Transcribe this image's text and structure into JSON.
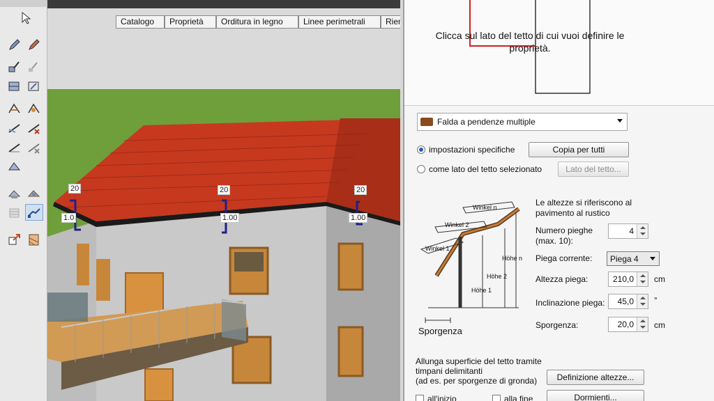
{
  "tabs": [
    "Catalogo",
    "Proprietà",
    "Orditura in legno",
    "Linee perimetrali",
    "Riempimento"
  ],
  "viewport": {
    "dims": [
      {
        "top": "20",
        "bottom": "1.0"
      },
      {
        "top": "20",
        "bottom": "1.00"
      },
      {
        "top": "20",
        "bottom": "1.00"
      }
    ],
    "colors": {
      "sky": "#d9d9d9",
      "grass": "#6f9f3a",
      "roof": "#c83a22",
      "wall": "#c8c8c8",
      "dim": "#20208a"
    }
  },
  "panel": {
    "preview_text": "Clicca sul lato del tetto di cui vuoi definire le proprietà.",
    "roof_type": {
      "label": "Falda a pendenze multiple",
      "icon": "roof-tile-icon"
    },
    "radio_specific": "impostazioni specifiche",
    "radio_selected_side": "come lato del tetto selezionato",
    "copy_all_button": "Copia per tutti",
    "roof_side_button": "Lato del tetto...",
    "diagram": {
      "winkel_n": "Winkel n",
      "winkel_2": "Winkel 2",
      "winkel_1": "Winkel 1",
      "hohe_n": "Höhe n",
      "hohe_2": "Höhe 2",
      "hohe_1": "Höhe 1",
      "sporgenza": "Sporgenza"
    },
    "note": "Le altezze si riferiscono al pavimento al rustico",
    "fields": {
      "num_folds_label": "Numero pieghe\n(max. 10):",
      "num_folds_value": "4",
      "current_fold_label": "Piega corrente:",
      "current_fold_value": "Piega 4",
      "fold_height_label": "Altezza piega:",
      "fold_height_value": "210,0",
      "fold_height_unit": "cm",
      "fold_incl_label": "Inclinazione piega:",
      "fold_incl_value": "45,0",
      "fold_incl_unit": "°",
      "overhang_label": "Sporgenza:",
      "overhang_value": "20,0",
      "overhang_unit": "cm"
    },
    "extend_text": "Allunga superficie del tetto tramite timpani delimitanti\n(ad es. per sporgenze di gronda)",
    "height_def_button": "Definizione altezze...",
    "check_start": "all'inizio",
    "check_end": "alla fine",
    "dormers_button": "Dormienti..."
  }
}
